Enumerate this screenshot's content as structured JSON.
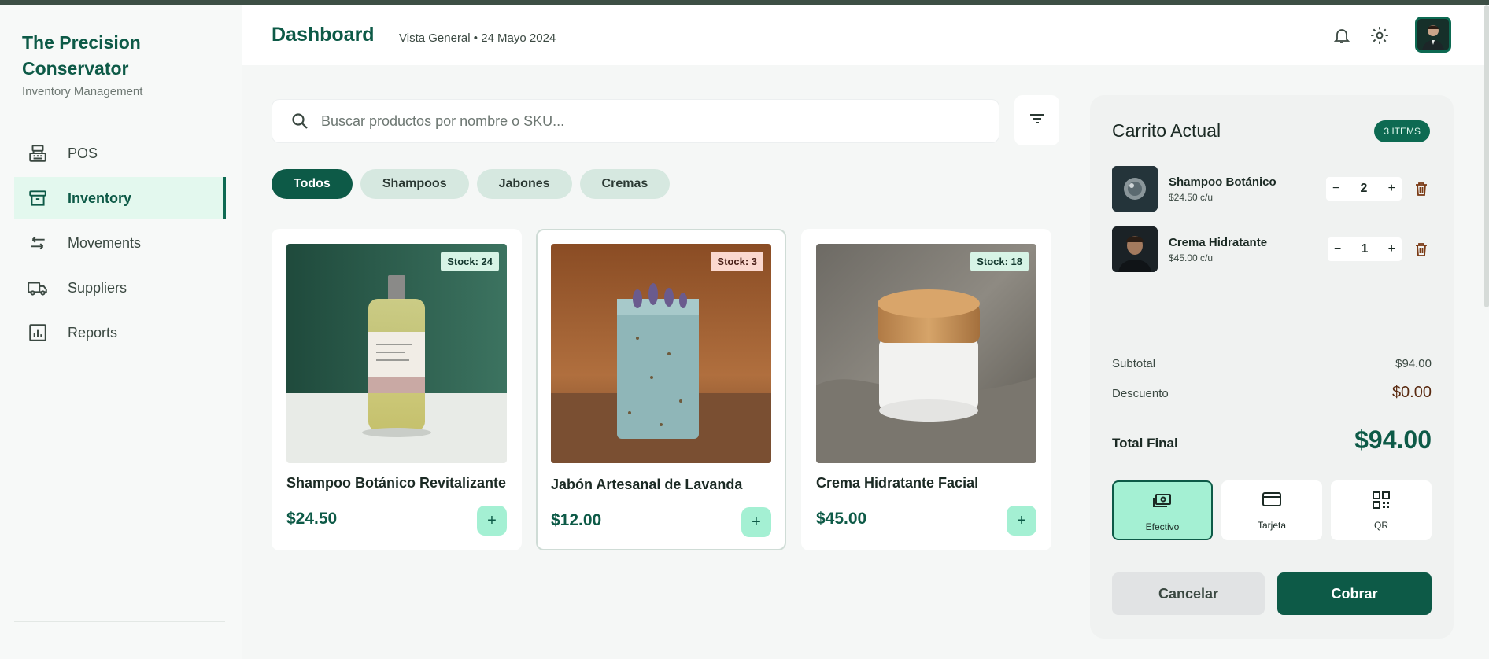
{
  "brand": {
    "title": "The Precision Conservator",
    "subtitle": "Inventory Management"
  },
  "sidebar": {
    "items": [
      {
        "label": "POS",
        "icon": "cash-register-icon",
        "active": false
      },
      {
        "label": "Inventory",
        "icon": "archive-box-icon",
        "active": true
      },
      {
        "label": "Movements",
        "icon": "swap-arrows-icon",
        "active": false
      },
      {
        "label": "Suppliers",
        "icon": "truck-icon",
        "active": false
      },
      {
        "label": "Reports",
        "icon": "bar-chart-icon",
        "active": false
      }
    ]
  },
  "header": {
    "title": "Dashboard",
    "subtitle": "Vista General • 24 Mayo 2024",
    "icons": [
      "bell-icon",
      "gear-icon",
      "avatar"
    ]
  },
  "search": {
    "placeholder": "Buscar productos por nombre o SKU...",
    "value": ""
  },
  "filters": {
    "chips": [
      {
        "label": "Todos",
        "active": true
      },
      {
        "label": "Shampoos",
        "active": false
      },
      {
        "label": "Jabones",
        "active": false
      },
      {
        "label": "Cremas",
        "active": false
      }
    ]
  },
  "products": [
    {
      "name": "Shampoo Botánico Revitalizante",
      "price": "$24.50",
      "stock": "Stock: 24",
      "stock_level": "ok",
      "add_label": "+"
    },
    {
      "name": "Jabón Artesanal de Lavanda",
      "price": "$12.00",
      "stock": "Stock: 3",
      "stock_level": "low",
      "add_label": "+"
    },
    {
      "name": "Crema Hidratante Facial",
      "price": "$45.00",
      "stock": "Stock: 18",
      "stock_level": "ok",
      "add_label": "+"
    }
  ],
  "cart": {
    "title": "Carrito Actual",
    "badge": "3 ITEMS",
    "items": [
      {
        "name": "Shampoo Botánico",
        "unit_price": "$24.50 c/u",
        "qty": "2",
        "minus": "−",
        "plus": "+"
      },
      {
        "name": "Crema Hidratante",
        "unit_price": "$45.00 c/u",
        "qty": "1",
        "minus": "−",
        "plus": "+"
      }
    ],
    "subtotal_label": "Subtotal",
    "subtotal": "$94.00",
    "discount_label": "Descuento",
    "discount": "$0.00",
    "total_label": "Total Final",
    "total": "$94.00",
    "payment_methods": [
      {
        "label": "Efectivo",
        "icon": "cash-icon",
        "active": true
      },
      {
        "label": "Tarjeta",
        "icon": "credit-card-icon",
        "active": false
      },
      {
        "label": "QR",
        "icon": "qr-code-icon",
        "active": false
      }
    ],
    "cancel_label": "Cancelar",
    "pay_label": "Cobrar"
  },
  "colors": {
    "brand": "#0d5a47",
    "accent": "#a4f0d3",
    "low_stock": "#fbd8cf"
  }
}
